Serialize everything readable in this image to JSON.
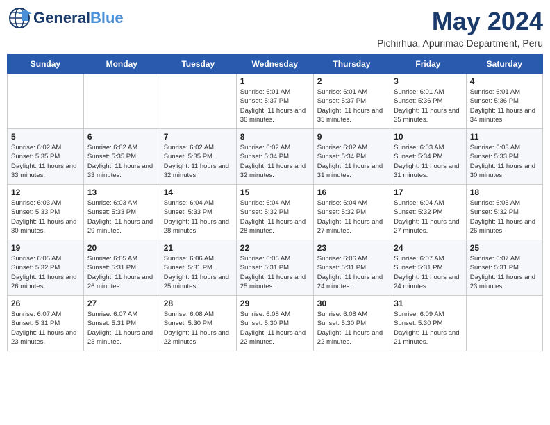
{
  "header": {
    "logo_general": "General",
    "logo_blue": "Blue",
    "month_title": "May 2024",
    "location": "Pichirhua, Apurimac Department, Peru"
  },
  "days_of_week": [
    "Sunday",
    "Monday",
    "Tuesday",
    "Wednesday",
    "Thursday",
    "Friday",
    "Saturday"
  ],
  "weeks": [
    [
      {
        "day": "",
        "info": ""
      },
      {
        "day": "",
        "info": ""
      },
      {
        "day": "",
        "info": ""
      },
      {
        "day": "1",
        "info": "Sunrise: 6:01 AM\nSunset: 5:37 PM\nDaylight: 11 hours and 36 minutes."
      },
      {
        "day": "2",
        "info": "Sunrise: 6:01 AM\nSunset: 5:37 PM\nDaylight: 11 hours and 35 minutes."
      },
      {
        "day": "3",
        "info": "Sunrise: 6:01 AM\nSunset: 5:36 PM\nDaylight: 11 hours and 35 minutes."
      },
      {
        "day": "4",
        "info": "Sunrise: 6:01 AM\nSunset: 5:36 PM\nDaylight: 11 hours and 34 minutes."
      }
    ],
    [
      {
        "day": "5",
        "info": "Sunrise: 6:02 AM\nSunset: 5:35 PM\nDaylight: 11 hours and 33 minutes."
      },
      {
        "day": "6",
        "info": "Sunrise: 6:02 AM\nSunset: 5:35 PM\nDaylight: 11 hours and 33 minutes."
      },
      {
        "day": "7",
        "info": "Sunrise: 6:02 AM\nSunset: 5:35 PM\nDaylight: 11 hours and 32 minutes."
      },
      {
        "day": "8",
        "info": "Sunrise: 6:02 AM\nSunset: 5:34 PM\nDaylight: 11 hours and 32 minutes."
      },
      {
        "day": "9",
        "info": "Sunrise: 6:02 AM\nSunset: 5:34 PM\nDaylight: 11 hours and 31 minutes."
      },
      {
        "day": "10",
        "info": "Sunrise: 6:03 AM\nSunset: 5:34 PM\nDaylight: 11 hours and 31 minutes."
      },
      {
        "day": "11",
        "info": "Sunrise: 6:03 AM\nSunset: 5:33 PM\nDaylight: 11 hours and 30 minutes."
      }
    ],
    [
      {
        "day": "12",
        "info": "Sunrise: 6:03 AM\nSunset: 5:33 PM\nDaylight: 11 hours and 30 minutes."
      },
      {
        "day": "13",
        "info": "Sunrise: 6:03 AM\nSunset: 5:33 PM\nDaylight: 11 hours and 29 minutes."
      },
      {
        "day": "14",
        "info": "Sunrise: 6:04 AM\nSunset: 5:33 PM\nDaylight: 11 hours and 28 minutes."
      },
      {
        "day": "15",
        "info": "Sunrise: 6:04 AM\nSunset: 5:32 PM\nDaylight: 11 hours and 28 minutes."
      },
      {
        "day": "16",
        "info": "Sunrise: 6:04 AM\nSunset: 5:32 PM\nDaylight: 11 hours and 27 minutes."
      },
      {
        "day": "17",
        "info": "Sunrise: 6:04 AM\nSunset: 5:32 PM\nDaylight: 11 hours and 27 minutes."
      },
      {
        "day": "18",
        "info": "Sunrise: 6:05 AM\nSunset: 5:32 PM\nDaylight: 11 hours and 26 minutes."
      }
    ],
    [
      {
        "day": "19",
        "info": "Sunrise: 6:05 AM\nSunset: 5:32 PM\nDaylight: 11 hours and 26 minutes."
      },
      {
        "day": "20",
        "info": "Sunrise: 6:05 AM\nSunset: 5:31 PM\nDaylight: 11 hours and 26 minutes."
      },
      {
        "day": "21",
        "info": "Sunrise: 6:06 AM\nSunset: 5:31 PM\nDaylight: 11 hours and 25 minutes."
      },
      {
        "day": "22",
        "info": "Sunrise: 6:06 AM\nSunset: 5:31 PM\nDaylight: 11 hours and 25 minutes."
      },
      {
        "day": "23",
        "info": "Sunrise: 6:06 AM\nSunset: 5:31 PM\nDaylight: 11 hours and 24 minutes."
      },
      {
        "day": "24",
        "info": "Sunrise: 6:07 AM\nSunset: 5:31 PM\nDaylight: 11 hours and 24 minutes."
      },
      {
        "day": "25",
        "info": "Sunrise: 6:07 AM\nSunset: 5:31 PM\nDaylight: 11 hours and 23 minutes."
      }
    ],
    [
      {
        "day": "26",
        "info": "Sunrise: 6:07 AM\nSunset: 5:31 PM\nDaylight: 11 hours and 23 minutes."
      },
      {
        "day": "27",
        "info": "Sunrise: 6:07 AM\nSunset: 5:31 PM\nDaylight: 11 hours and 23 minutes."
      },
      {
        "day": "28",
        "info": "Sunrise: 6:08 AM\nSunset: 5:30 PM\nDaylight: 11 hours and 22 minutes."
      },
      {
        "day": "29",
        "info": "Sunrise: 6:08 AM\nSunset: 5:30 PM\nDaylight: 11 hours and 22 minutes."
      },
      {
        "day": "30",
        "info": "Sunrise: 6:08 AM\nSunset: 5:30 PM\nDaylight: 11 hours and 22 minutes."
      },
      {
        "day": "31",
        "info": "Sunrise: 6:09 AM\nSunset: 5:30 PM\nDaylight: 11 hours and 21 minutes."
      },
      {
        "day": "",
        "info": ""
      }
    ]
  ]
}
